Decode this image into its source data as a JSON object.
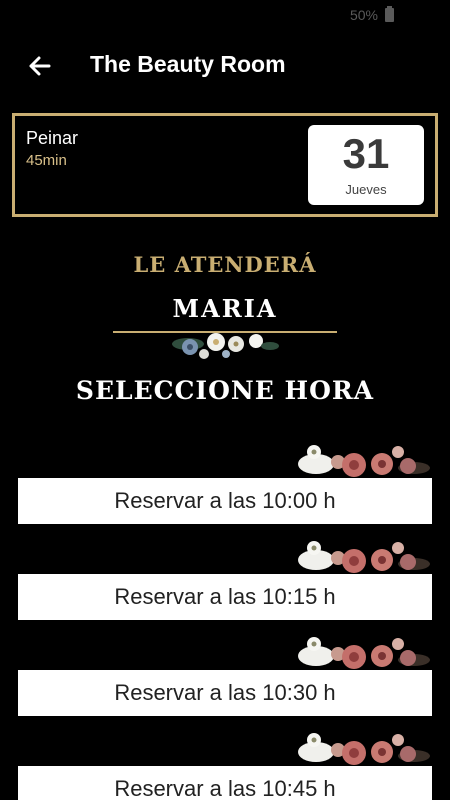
{
  "status_bar": {
    "battery": "50%"
  },
  "app_bar": {
    "title": "The Beauty Room"
  },
  "service": {
    "name": "Peinar",
    "duration": "45min",
    "date_day": "31",
    "date_weekday": "Jueves"
  },
  "header": {
    "attend_label": "LE ATENDERÁ",
    "staff_name": "MARIA",
    "select_label": "SELECCIONE HORA"
  },
  "colors": {
    "gold": "#c9ae72",
    "background": "#000000",
    "button": "#ffffff"
  },
  "slots": [
    {
      "label": "Reservar a las 10:00 h"
    },
    {
      "label": "Reservar a las 10:15 h"
    },
    {
      "label": "Reservar a las 10:30 h"
    },
    {
      "label": "Reservar a las 10:45 h"
    }
  ]
}
